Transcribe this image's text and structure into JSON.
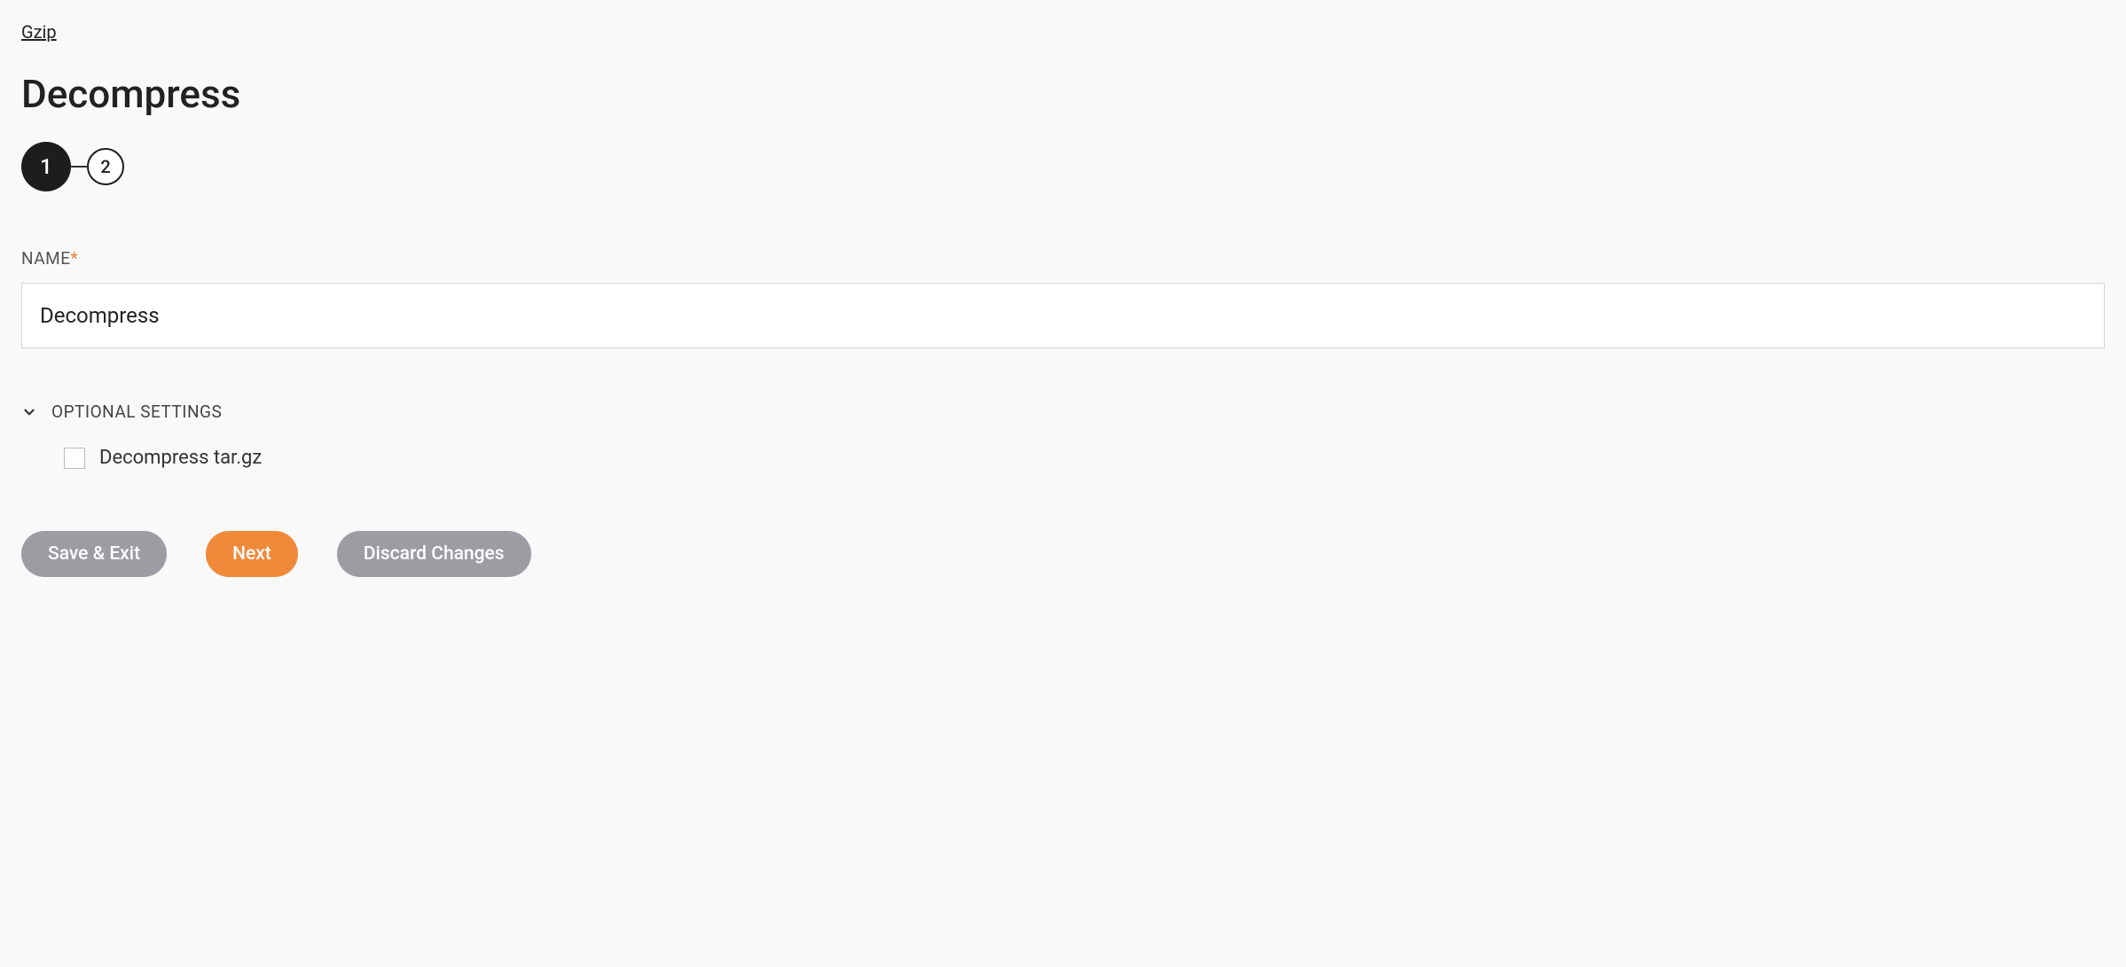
{
  "breadcrumb": {
    "label": "Gzip"
  },
  "page": {
    "title": "Decompress"
  },
  "stepper": {
    "steps": [
      "1",
      "2"
    ],
    "active_index": 0
  },
  "form": {
    "name_label": "NAME",
    "name_required_mark": "*",
    "name_value": "Decompress"
  },
  "optional_section": {
    "header": "OPTIONAL SETTINGS",
    "expanded": true,
    "decompress_targz_label": "Decompress tar.gz",
    "decompress_targz_checked": false
  },
  "buttons": {
    "save_exit": "Save & Exit",
    "next": "Next",
    "discard": "Discard Changes"
  }
}
